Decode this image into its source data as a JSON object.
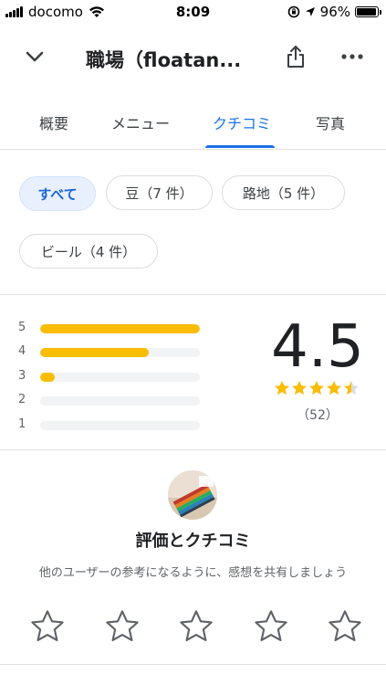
{
  "status_bar": {
    "carrier": "docomo",
    "time": "8:09",
    "battery": "96%",
    "battery_level": 0.96
  },
  "header": {
    "title": "職場（floatan...",
    "back_icon": "chevron-down-icon",
    "share_icon": "share-icon",
    "more_icon": "more-horizontal-icon"
  },
  "tabs": [
    {
      "label": "概要",
      "active": false
    },
    {
      "label": "メニュー",
      "active": false
    },
    {
      "label": "クチコミ",
      "active": true
    },
    {
      "label": "写真",
      "active": false
    }
  ],
  "chips": [
    {
      "label": "すべて",
      "selected": true
    },
    {
      "label": "豆（7 件）",
      "selected": false
    },
    {
      "label": "路地（5 件）",
      "selected": false
    },
    {
      "label": "ビール（4 件）",
      "selected": false
    }
  ],
  "rating_summary": {
    "average": "4.5",
    "stars_value": 4.5,
    "review_count": "（52）",
    "histogram": [
      {
        "label": "5",
        "fraction": 1.0
      },
      {
        "label": "4",
        "fraction": 0.68
      },
      {
        "label": "3",
        "fraction": 0.09
      },
      {
        "label": "2",
        "fraction": 0.0
      },
      {
        "label": "1",
        "fraction": 0.0
      }
    ]
  },
  "write_review": {
    "title": "評価とクチコミ",
    "subtitle": "他のユーザーの参考になるように、感想を共有しましょう",
    "star_count": 5
  },
  "colors": {
    "accent": "#1a73e8",
    "star": "#fbbc04",
    "chip_selected_bg": "#e8f0fe"
  }
}
